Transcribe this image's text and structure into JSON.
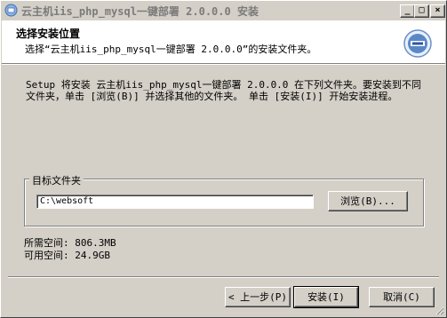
{
  "window": {
    "title": "云主机iis_php_mysql一键部署 2.0.0.0 安装",
    "buttons": {
      "minimize": "_",
      "maximize": "□",
      "close": "×"
    }
  },
  "header": {
    "title": "选择安装位置",
    "subtitle": "选择“云主机iis_php_mysql一键部署 2.0.0.0”的安装文件夹。"
  },
  "description": "Setup 将安装 云主机iis_php_mysql一键部署 2.0.0.0 在下列文件夹。要安装到不同\n文件夹，单击 [浏览(B)] 并选择其他的文件夹。 单击 [安装(I)] 开始安装进程。",
  "destination": {
    "group_label": "目标文件夹",
    "path_value": "C:\\websoft",
    "browse_label": "浏览(B)..."
  },
  "space": {
    "required": "所需空间: 806.3MB",
    "available": "可用空间: 24.9GB"
  },
  "footer": {
    "back_label": "< 上一步(P)",
    "install_label": "安装(I)",
    "cancel_label": "取消(C)"
  }
}
